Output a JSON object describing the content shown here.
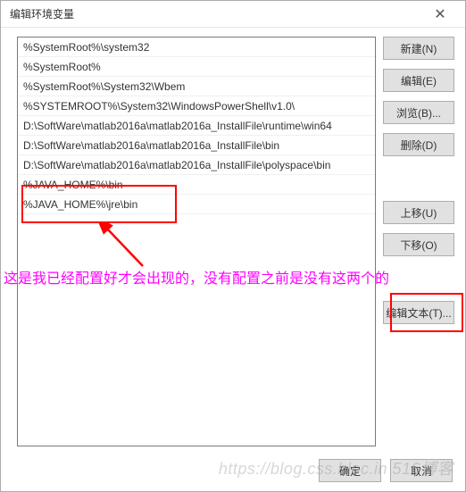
{
  "dialog": {
    "title": "编辑环境变量"
  },
  "list": {
    "items": [
      "%SystemRoot%\\system32",
      "%SystemRoot%",
      "%SystemRoot%\\System32\\Wbem",
      "%SYSTEMROOT%\\System32\\WindowsPowerShell\\v1.0\\",
      "D:\\SoftWare\\matlab2016a\\matlab2016a_InstallFile\\runtime\\win64",
      "D:\\SoftWare\\matlab2016a\\matlab2016a_InstallFile\\bin",
      "D:\\SoftWare\\matlab2016a\\matlab2016a_InstallFile\\polyspace\\bin",
      "%JAVA_HOME%\\bin",
      "%JAVA_HOME%\\jre\\bin"
    ]
  },
  "buttons": {
    "new": "新建(N)",
    "edit": "编辑(E)",
    "browse": "浏览(B)...",
    "delete": "删除(D)",
    "move_up": "上移(U)",
    "move_down": "下移(O)",
    "edit_text": "编辑文本(T)...",
    "ok": "确定",
    "cancel": "取消"
  },
  "annotation": {
    "text": "这是我已经配置好才会出现的，没有配置之前是没有这两个的"
  },
  "watermark": "https://blog.css.bloc.in 516博客"
}
